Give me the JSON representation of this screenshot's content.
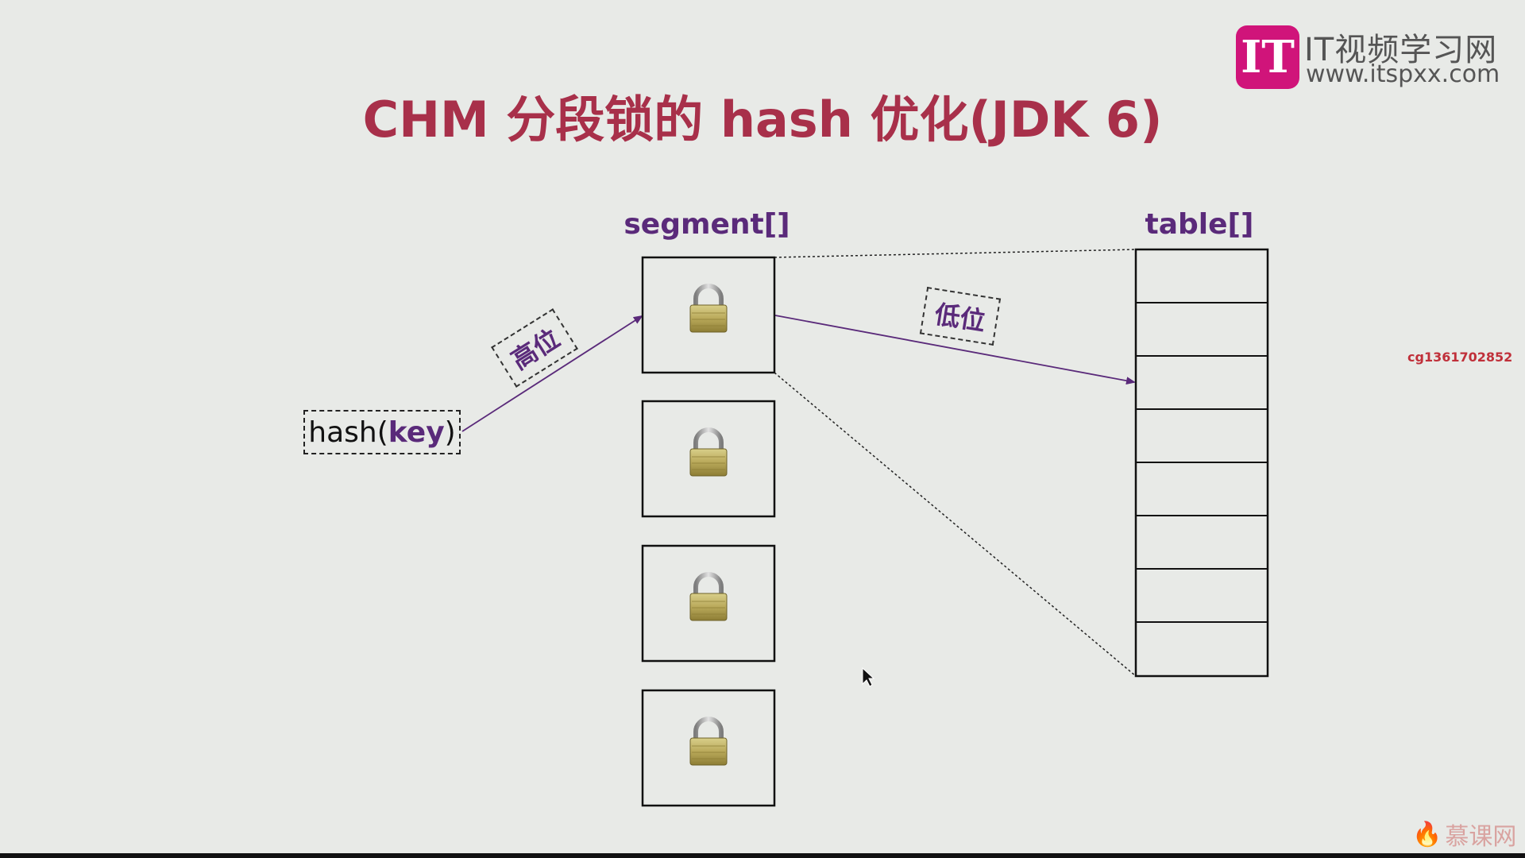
{
  "title": "CHM 分段锁的 hash 优化(JDK 6)",
  "logo": {
    "mark": "IT",
    "title": "IT视频学习网",
    "url": "www.itspxx.com"
  },
  "watermark": "cg1361702852",
  "mooc_logo": {
    "text": "慕课网",
    "icon": "flame-icon"
  },
  "labels": {
    "segment": "segment[]",
    "table": "table[]"
  },
  "hash_box": {
    "prefix": "hash(",
    "key": "key",
    "suffix": ")"
  },
  "tags": {
    "high": "高位",
    "low": "低位"
  },
  "segment": {
    "count": 4,
    "icon": "padlock-icon"
  },
  "table": {
    "rows": 8
  },
  "colors": {
    "title": "#a8304a",
    "label": "#5a2a7a",
    "arrow": "#5a2a7a",
    "logo": "#d0147a",
    "watermark": "#c0303a"
  }
}
